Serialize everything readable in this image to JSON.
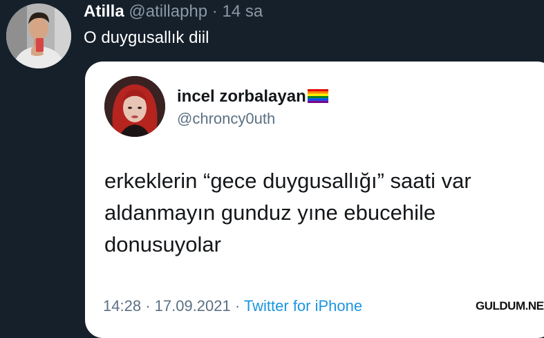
{
  "tweet": {
    "display_name": "Atilla",
    "handle": "@atillaphp",
    "separator": "·",
    "time": "14 sa",
    "text": "O duygusallık diil"
  },
  "quoted_tweet": {
    "display_name": "incel zorbalayan",
    "flag_icon": "rainbow-flag-icon",
    "handle": "@chroncy0uth",
    "lines": [
      "erkeklerin “gece duygusallığı” saati var",
      "aldanmayın gunduz yıne ebucehile",
      "donusuyolar"
    ],
    "time": "14:28",
    "date": "17.09.2021",
    "source": "Twitter for iPhone",
    "separator": "·"
  },
  "watermark": "GULDUM.NET",
  "colors": {
    "background": "#15202b",
    "card": "#ffffff",
    "link": "#1b95e0",
    "secondary_text": "#8b98a5"
  }
}
